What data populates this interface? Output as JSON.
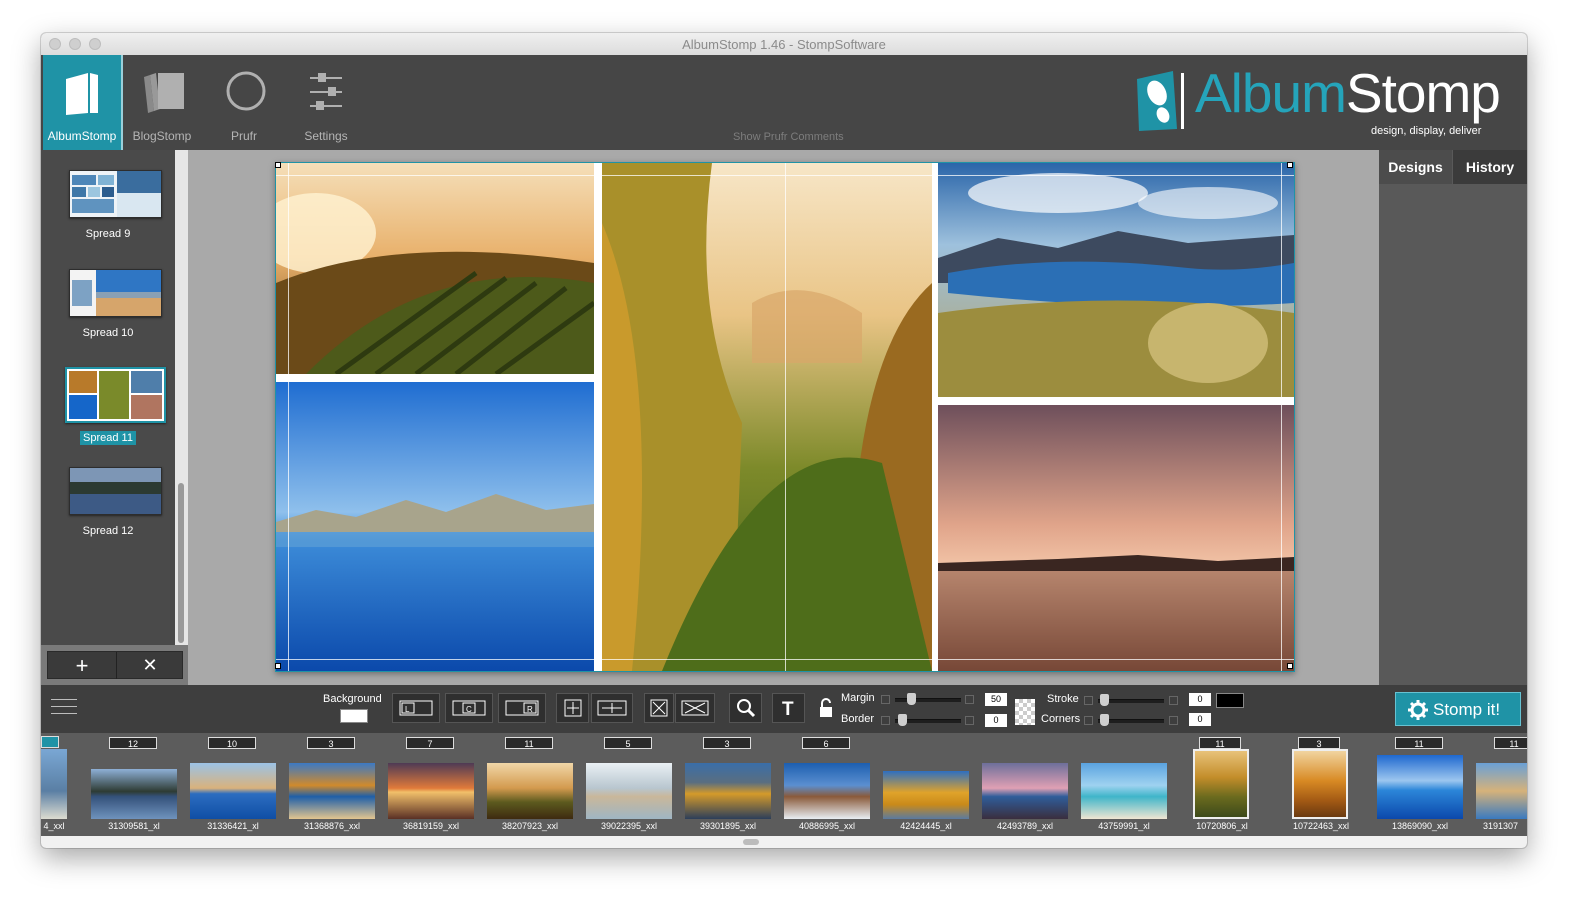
{
  "window": {
    "title": "AlbumStomp 1.46 - StompSoftware"
  },
  "modes": [
    {
      "label": "AlbumStomp",
      "icon": "album-icon",
      "active": true
    },
    {
      "label": "BlogStomp",
      "icon": "blog-icon",
      "active": false
    },
    {
      "label": "Prufr",
      "icon": "prufr-circle-icon",
      "active": false
    },
    {
      "label": "Settings",
      "icon": "sliders-icon",
      "active": false
    }
  ],
  "header": {
    "prufr_comments": "Show Prufr Comments"
  },
  "logo": {
    "word_album": "Album",
    "word_stomp": "Stomp",
    "tagline": "design, display, deliver"
  },
  "spreads": [
    {
      "label": "Spread 9",
      "selected": false
    },
    {
      "label": "Spread 10",
      "selected": false
    },
    {
      "label": "Spread 11",
      "selected": true
    },
    {
      "label": "Spread 12",
      "selected": false
    }
  ],
  "spread_controls": {
    "add": "+",
    "remove": "✕"
  },
  "right_tabs": [
    {
      "label": "Designs",
      "active": true
    },
    {
      "label": "History",
      "active": false
    }
  ],
  "toolbar": {
    "background_label": "Background",
    "align_left": "L",
    "align_center": "C",
    "align_right": "R",
    "margin_label": "Margin",
    "margin_value": "50",
    "border_label": "Border",
    "border_value": "0",
    "stroke_label": "Stroke",
    "stroke_value": "0",
    "corners_label": "Corners",
    "corners_value": "0",
    "stroke_color": "#000000",
    "text_tool": "T"
  },
  "stomp_button": {
    "label": "Stomp it!"
  },
  "filmstrip": [
    {
      "badge": "",
      "name": "4_xxl"
    },
    {
      "badge": "12",
      "name": "31309581_xl"
    },
    {
      "badge": "10",
      "name": "31336421_xl"
    },
    {
      "badge": "3",
      "name": "31368876_xxl"
    },
    {
      "badge": "7",
      "name": "36819159_xxl"
    },
    {
      "badge": "11",
      "name": "38207923_xxl"
    },
    {
      "badge": "5",
      "name": "39022395_xxl"
    },
    {
      "badge": "3",
      "name": "39301895_xxl"
    },
    {
      "badge": "6",
      "name": "40886995_xxl"
    },
    {
      "badge": "",
      "name": "42424445_xl"
    },
    {
      "badge": "",
      "name": "42493789_xxl"
    },
    {
      "badge": "",
      "name": "43759991_xl"
    },
    {
      "badge": "11",
      "name": "10720806_xl"
    },
    {
      "badge": "3",
      "name": "10722463_xxl"
    },
    {
      "badge": "11",
      "name": "13869090_xxl"
    },
    {
      "badge": "11",
      "name": "3191307"
    }
  ],
  "colors": {
    "accent": "#1f93a6",
    "topbar": "#464646",
    "panel": "#4a4a4a"
  }
}
